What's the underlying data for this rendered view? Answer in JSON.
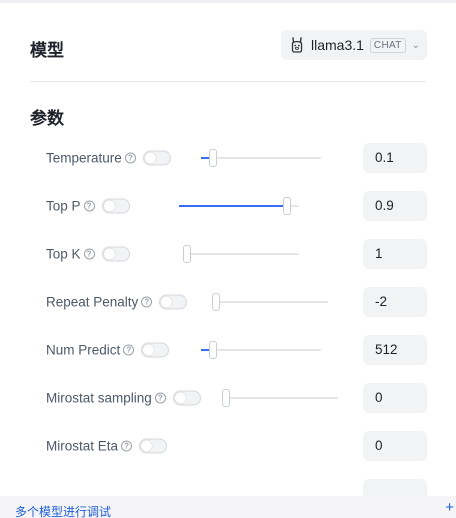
{
  "model_section": {
    "title": "模型",
    "selected_model": "llama3.1",
    "tag": "CHAT",
    "model_icon": "llama-icon"
  },
  "params_section": {
    "title": "参数",
    "params": [
      {
        "label": "Temperature",
        "value": "0.1",
        "enabled": false,
        "level": 0.1
      },
      {
        "label": "Top P",
        "value": "0.9",
        "enabled": false,
        "level": 0.9
      },
      {
        "label": "Top K",
        "value": "1",
        "enabled": false,
        "level": 0.0
      },
      {
        "label": "Repeat Penalty",
        "value": "-2",
        "enabled": false,
        "level": 0.0
      },
      {
        "label": "Num Predict",
        "value": "512",
        "enabled": false,
        "level": 0.1
      },
      {
        "label": "Mirostat sampling",
        "value": "0",
        "enabled": false,
        "level": 0.0
      },
      {
        "label": "Mirostat Eta",
        "value": "0",
        "enabled": false,
        "level": null
      }
    ]
  },
  "footer": {
    "link": "多个模型进行调试",
    "plus_icon": "plus-icon"
  },
  "colors": {
    "accent": "#3b6cf5",
    "input_bg": "#f2f3f5",
    "link": "#1e5fd9"
  }
}
